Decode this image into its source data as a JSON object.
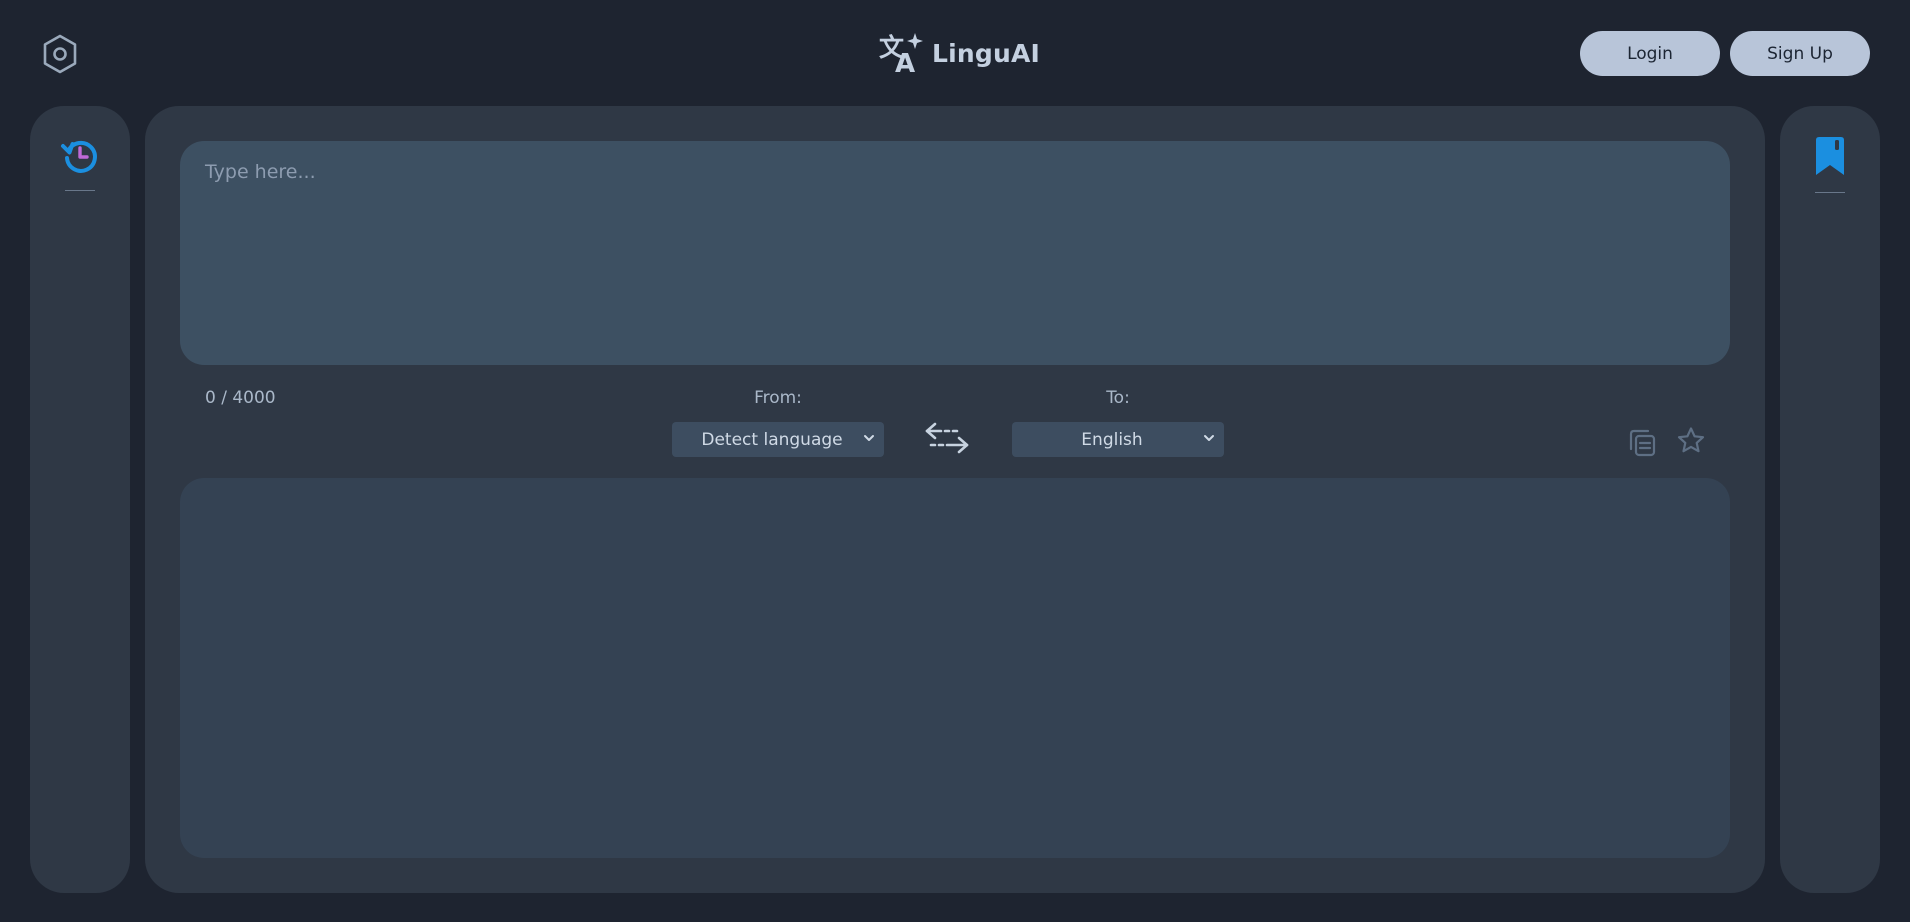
{
  "app": {
    "name": "LinguAI"
  },
  "header": {
    "settings_icon": "settings-hexagon-icon",
    "logo_icon": "translate-sparkle-icon",
    "login_label": "Login",
    "signup_label": "Sign Up"
  },
  "sidebar_left": {
    "icon": "history-icon"
  },
  "sidebar_right": {
    "icon": "bookmark-icon"
  },
  "translator": {
    "input": {
      "value": "",
      "placeholder": "Type here..."
    },
    "char_count": "0 / 4000",
    "from_label": "From:",
    "from_selected": "Detect language",
    "to_label": "To:",
    "to_selected": "English",
    "swap_icon": "swap-arrows-icon",
    "copy_icon": "copy-icon",
    "favorite_icon": "star-icon",
    "output": {
      "value": ""
    }
  },
  "colors": {
    "background": "#1e2430",
    "panel": "#2f3845",
    "input": "#3d5062",
    "output": "#344253",
    "button": "#b8c5d9",
    "accent_blue": "#1b8fe0",
    "accent_purple": "#c06ad8"
  }
}
